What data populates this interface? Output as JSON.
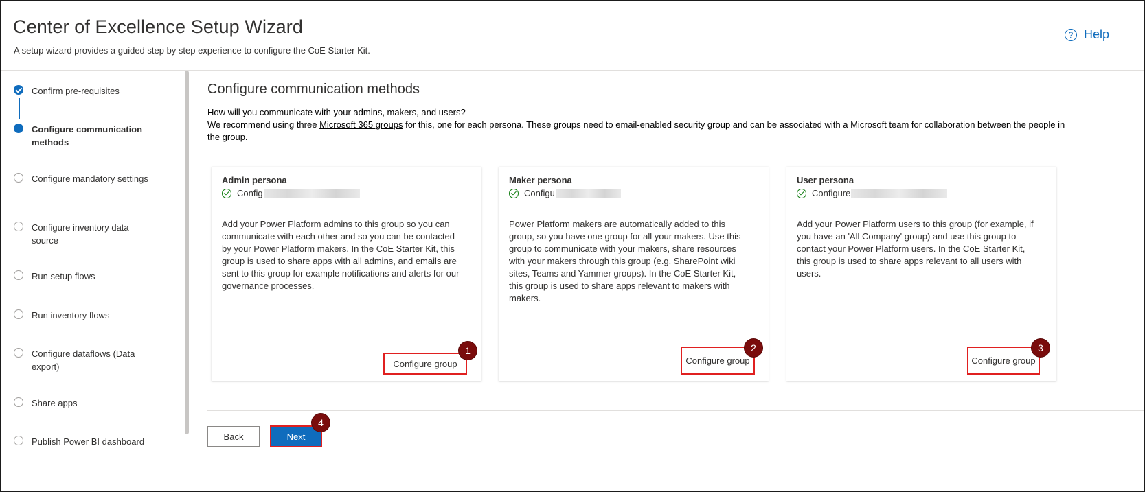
{
  "header": {
    "title": "Center of Excellence Setup Wizard",
    "subtitle": "A setup wizard provides a guided step by step experience to configure the CoE Starter Kit.",
    "help_label": "Help",
    "help_icon": "question-circle-icon"
  },
  "steps": [
    {
      "label": "Confirm pre-requisites",
      "state": "completed"
    },
    {
      "label": "Configure communication methods",
      "state": "current"
    },
    {
      "label": "Configure mandatory settings",
      "state": "pending"
    },
    {
      "label": "Configure inventory data source",
      "state": "pending"
    },
    {
      "label": "Run setup flows",
      "state": "pending"
    },
    {
      "label": "Run inventory flows",
      "state": "pending"
    },
    {
      "label": "Configure dataflows (Data export)",
      "state": "pending"
    },
    {
      "label": "Share apps",
      "state": "pending"
    },
    {
      "label": "Publish Power BI dashboard",
      "state": "pending"
    }
  ],
  "main": {
    "title": "Configure communication methods",
    "question": "How will you communicate with your admins, makers, and users?",
    "recommend_before": "We recommend using three ",
    "recommend_link": "Microsoft 365 groups",
    "recommend_after": " for this, one for each persona. These groups need to email-enabled security group and can be associated with a Microsoft team for collaboration between the people in the group."
  },
  "cards": [
    {
      "title": "Admin persona",
      "status_visible": "Config",
      "description": "Add your Power Platform admins to this group so you can communicate with each other and so you can be contacted by your Power Platform makers. In the CoE Starter Kit, this group is used to share apps with all admins, and emails are sent to this group for example notifications and alerts for our governance processes.",
      "button_label": "Configure group",
      "badge": "1"
    },
    {
      "title": "Maker persona",
      "status_visible": "Configu",
      "description": "Power Platform makers are automatically added to this group, so you have one group for all your makers. Use this group to communicate with your makers, share resources with your makers through this group (e.g. SharePoint wiki sites, Teams and Yammer groups). In the CoE Starter Kit, this group is used to share apps relevant to makers with makers.",
      "button_label": "Configure group",
      "badge": "2"
    },
    {
      "title": "User persona",
      "status_visible": "Configure",
      "description": "Add your Power Platform users to this group (for example, if you have an 'All Company' group) and use this group to contact your Power Platform users. In the CoE Starter Kit, this group is used to share apps relevant to all users with users.",
      "button_label": "Configure group",
      "badge": "3"
    }
  ],
  "footer": {
    "back_label": "Back",
    "next_label": "Next",
    "next_badge": "4"
  },
  "colors": {
    "accent": "#0f6cbd",
    "success": "#107c10",
    "highlight_border": "#e02020",
    "badge": "#7a0c0c"
  }
}
